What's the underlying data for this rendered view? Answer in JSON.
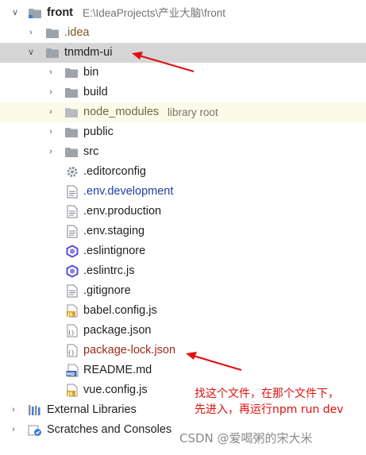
{
  "tree": {
    "root": {
      "name": "front",
      "path": "E:\\IdeaProjects\\产业大脑\\front"
    },
    "idea": ".idea",
    "module": "tnmdm-ui",
    "folders": [
      "bin",
      "build",
      "node_modules",
      "public",
      "src"
    ],
    "node_modules_hint": "library root",
    "files": [
      ".editorconfig",
      ".env.development",
      ".env.production",
      ".env.staging",
      ".eslintignore",
      ".eslintrc.js",
      ".gitignore",
      "babel.config.js",
      "package.json",
      "package-lock.json",
      "README.md",
      "vue.config.js"
    ],
    "external_libraries": "External Libraries",
    "scratches": "Scratches and Consoles"
  },
  "annotation": {
    "note_line1": "找这个文件，在那个文件下，",
    "note_line2": "先进入，再运行npm run dev"
  },
  "watermark": "CSDN @爱喝粥的宋大米",
  "colors": {
    "selection": "#d5d5d5",
    "library_row": "#fbfbea",
    "modified_blue": "#1f3f9f",
    "ignored_red": "#9b2a1a",
    "arrow_red": "#e01010",
    "folder_gray": "#9da3aa"
  }
}
